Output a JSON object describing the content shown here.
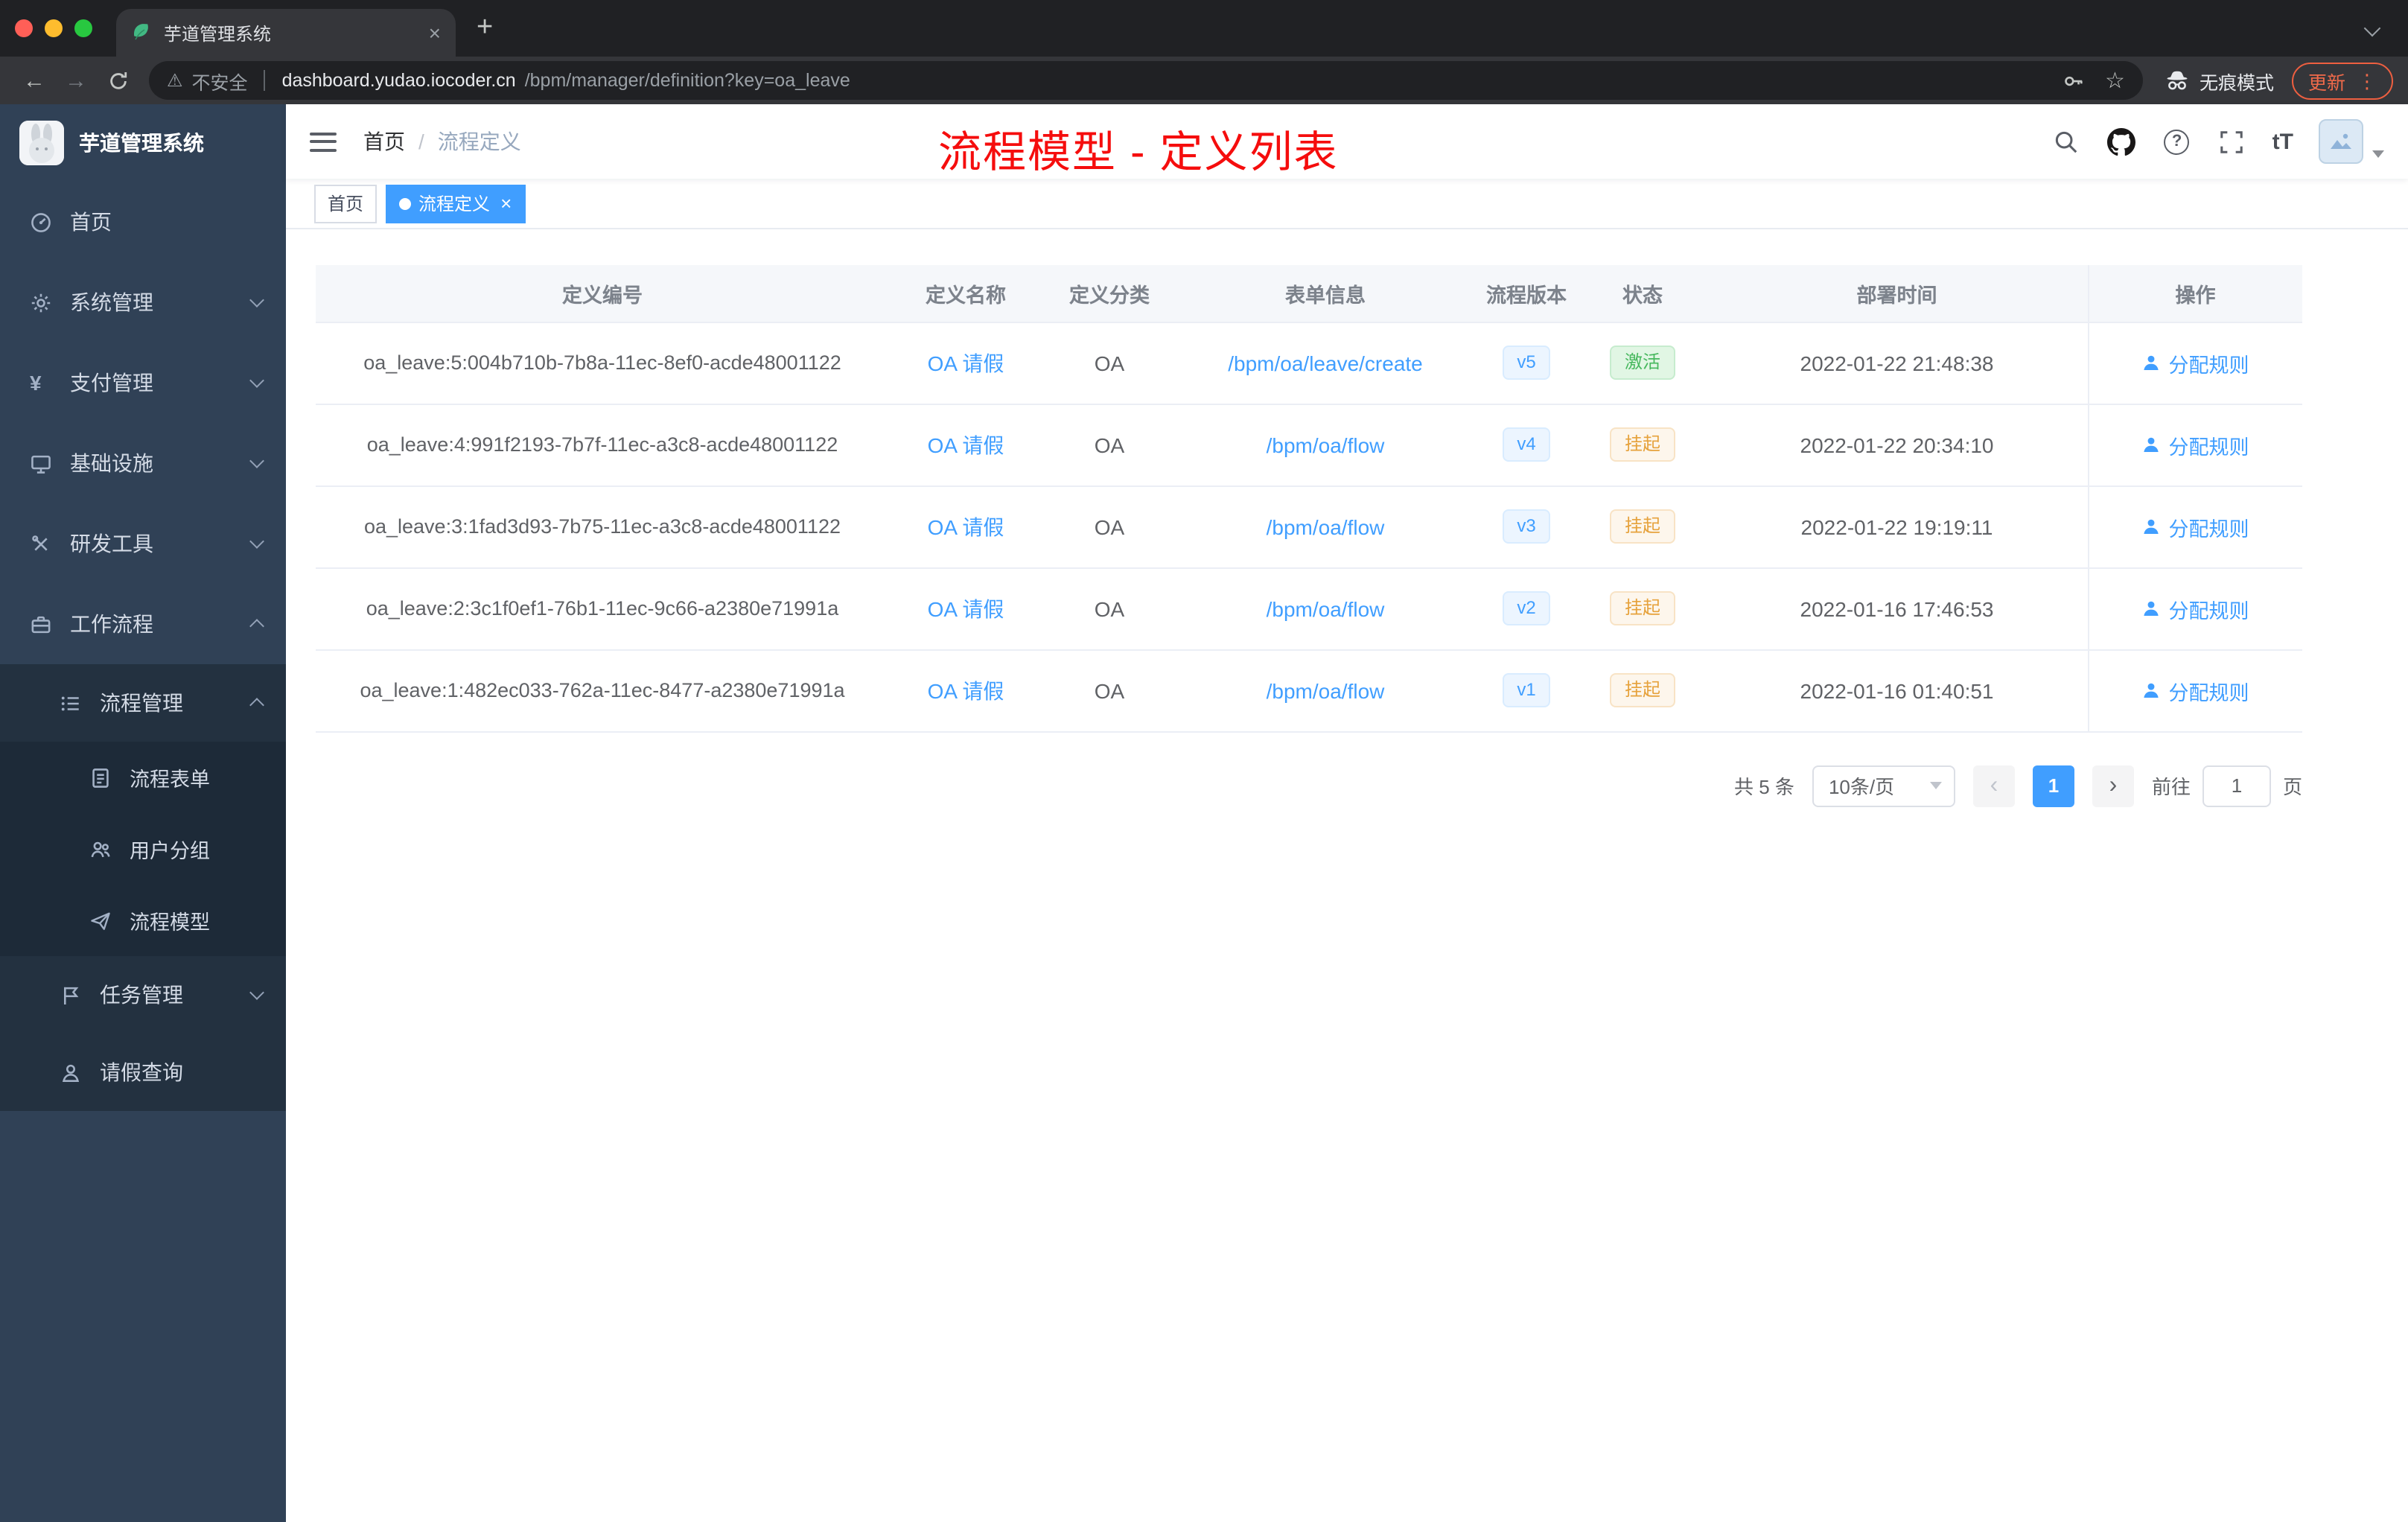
{
  "browser": {
    "tab": {
      "title": "芋道管理系统"
    },
    "address": {
      "security": "不安全",
      "host": "dashboard.yudao.iocoder.cn",
      "path": "/bpm/manager/definition?key=oa_leave"
    },
    "incognito_label": "无痕模式",
    "update_label": "更新"
  },
  "sidebar": {
    "app_title": "芋道管理系统",
    "menu": [
      {
        "key": "home",
        "label": "首页",
        "icon": "dashboard-icon",
        "level": 0,
        "expandable": false,
        "expanded": false
      },
      {
        "key": "system",
        "label": "系统管理",
        "icon": "gear-icon",
        "level": 0,
        "expandable": true,
        "expanded": false
      },
      {
        "key": "payment",
        "label": "支付管理",
        "icon": "yen-icon",
        "level": 0,
        "expandable": true,
        "expanded": false
      },
      {
        "key": "infrastructure",
        "label": "基础设施",
        "icon": "monitor-icon",
        "level": 0,
        "expandable": true,
        "expanded": false
      },
      {
        "key": "dev-tools",
        "label": "研发工具",
        "icon": "tools-icon",
        "level": 0,
        "expandable": true,
        "expanded": false
      },
      {
        "key": "workflow",
        "label": "工作流程",
        "icon": "briefcase-icon",
        "level": 0,
        "expandable": true,
        "expanded": true
      },
      {
        "key": "process-management",
        "label": "流程管理",
        "icon": "list-icon",
        "level": 1,
        "expandable": true,
        "expanded": true
      },
      {
        "key": "process-form",
        "label": "流程表单",
        "icon": "form-icon",
        "level": 2,
        "expandable": false,
        "expanded": false
      },
      {
        "key": "user-group",
        "label": "用户分组",
        "icon": "users-icon",
        "level": 2,
        "expandable": false,
        "expanded": false
      },
      {
        "key": "process-model",
        "label": "流程模型",
        "icon": "send-icon",
        "level": 2,
        "expandable": false,
        "expanded": false
      },
      {
        "key": "task-management",
        "label": "任务管理",
        "icon": "task-icon",
        "level": 1,
        "expandable": true,
        "expanded": false
      },
      {
        "key": "leave-query",
        "label": "请假查询",
        "icon": "person-icon",
        "level": 1,
        "expandable": false,
        "expanded": false
      }
    ]
  },
  "header": {
    "breadcrumb": [
      "首页",
      "流程定义"
    ],
    "breadcrumb_separator": "/",
    "annotation": "流程模型 - 定义列表",
    "font_size_icon_label": "tT"
  },
  "tags": [
    {
      "key": "home",
      "label": "首页",
      "active": false,
      "closable": false
    },
    {
      "key": "process-definition",
      "label": "流程定义",
      "active": true,
      "closable": true
    }
  ],
  "table": {
    "columns": [
      "定义编号",
      "定义名称",
      "定义分类",
      "表单信息",
      "流程版本",
      "状态",
      "部署时间",
      "操作"
    ],
    "rows": [
      {
        "id": "oa_leave:5:004b710b-7b8a-11ec-8ef0-acde48001122",
        "name": "OA 请假",
        "category": "OA",
        "form": "/bpm/oa/leave/create",
        "version": "v5",
        "status": "激活",
        "status_type": "success",
        "deployed": "2022-01-22 21:48:38",
        "action": "分配规则"
      },
      {
        "id": "oa_leave:4:991f2193-7b7f-11ec-a3c8-acde48001122",
        "name": "OA 请假",
        "category": "OA",
        "form": "/bpm/oa/flow",
        "version": "v4",
        "status": "挂起",
        "status_type": "warning",
        "deployed": "2022-01-22 20:34:10",
        "action": "分配规则"
      },
      {
        "id": "oa_leave:3:1fad3d93-7b75-11ec-a3c8-acde48001122",
        "name": "OA 请假",
        "category": "OA",
        "form": "/bpm/oa/flow",
        "version": "v3",
        "status": "挂起",
        "status_type": "warning",
        "deployed": "2022-01-22 19:19:11",
        "action": "分配规则"
      },
      {
        "id": "oa_leave:2:3c1f0ef1-76b1-11ec-9c66-a2380e71991a",
        "name": "OA 请假",
        "category": "OA",
        "form": "/bpm/oa/flow",
        "version": "v2",
        "status": "挂起",
        "status_type": "warning",
        "deployed": "2022-01-16 17:46:53",
        "action": "分配规则"
      },
      {
        "id": "oa_leave:1:482ec033-762a-11ec-8477-a2380e71991a",
        "name": "OA 请假",
        "category": "OA",
        "form": "/bpm/oa/flow",
        "version": "v1",
        "status": "挂起",
        "status_type": "warning",
        "deployed": "2022-01-16 01:40:51",
        "action": "分配规则"
      }
    ]
  },
  "pagination": {
    "total": "共 5 条",
    "page_size": "10条/页",
    "current": "1",
    "goto_prefix": "前往",
    "goto_value": "1",
    "goto_suffix": "页"
  },
  "colors": {
    "accent": "#409eff",
    "success": "#47b85e",
    "warning": "#e6a23c",
    "annotation_red": "#f50d0d",
    "sidebar_bg": "#304156",
    "submenu_bg": "#1d2a38",
    "update_orange": "#f06a4a"
  }
}
